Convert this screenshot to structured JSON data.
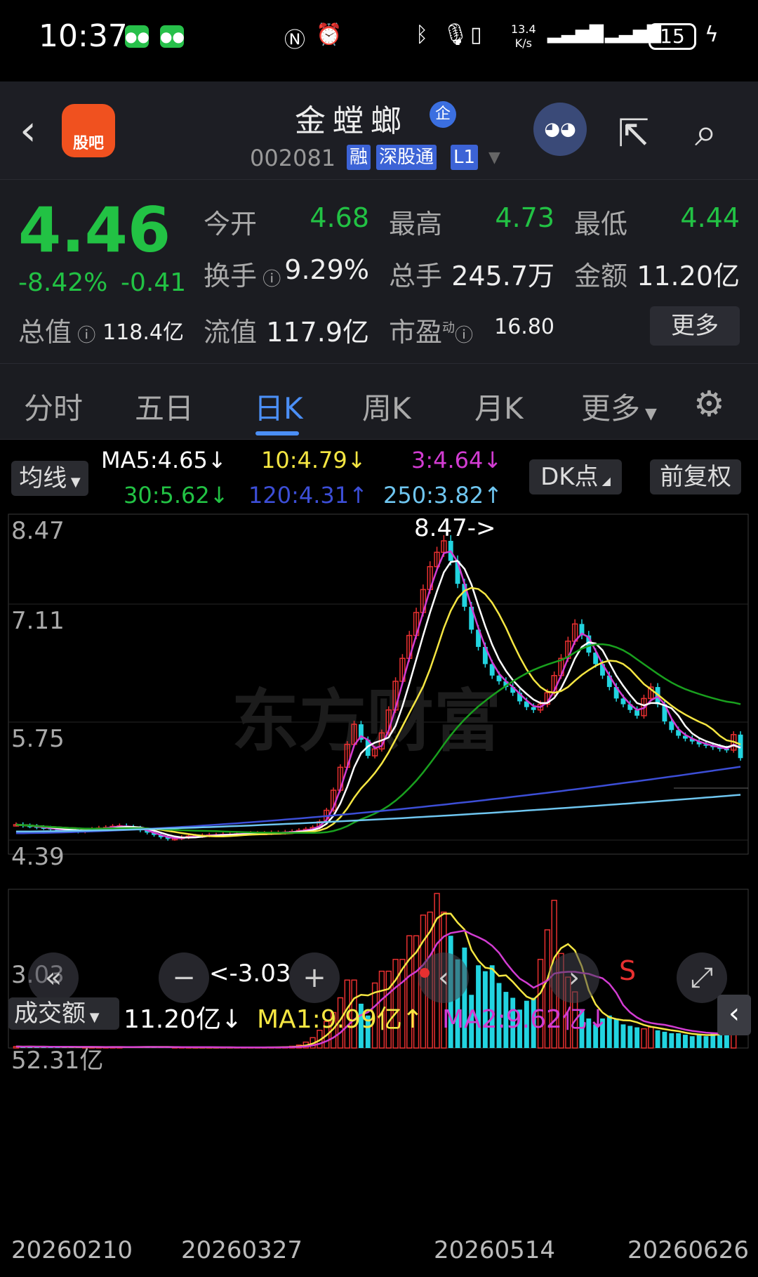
{
  "status_bar": {
    "time": "10:37",
    "net_speed_value": "13.4",
    "net_speed_unit": "K/s",
    "battery": "15"
  },
  "header": {
    "back": "‹",
    "guba_label": "股吧",
    "stock_name": "金螳螂",
    "qi_badge": "企",
    "code": "002081",
    "tags": [
      "融",
      "深股通",
      "L1"
    ]
  },
  "quote": {
    "price": "4.46",
    "change_pct": "-8.42%",
    "change_abs": "-0.41",
    "open_label": "今开",
    "open": "4.68",
    "high_label": "最高",
    "high": "4.73",
    "low_label": "最低",
    "low": "4.44",
    "turnover_label": "换手",
    "turnover": "9.29%",
    "volume_label": "总手",
    "volume": "245.7万",
    "amount_label": "金额",
    "amount": "11.20亿",
    "mktcap_label": "总值",
    "mktcap": "118.4亿",
    "float_label": "流值",
    "float_cap": "117.9亿",
    "pe_label": "市盈",
    "pe_sup": "动",
    "pe": "16.80",
    "more": "更多"
  },
  "tabs": [
    "分时",
    "五日",
    "日K",
    "周K",
    "月K",
    "更多"
  ],
  "active_tab": "日K",
  "indicators": {
    "ma_btn": "均线",
    "ma5": "MA5:4.65↓",
    "ma10": "10:4.79↓",
    "ma3": "3:4.64↓",
    "ma30": "30:5.62↓",
    "ma120": "120:4.31↑",
    "ma250": "250:3.82↑",
    "dk_btn": "DK点",
    "adj_btn": "前复权"
  },
  "colors": {
    "up": "#e83030",
    "down": "#22d4e0",
    "green": "#22c244",
    "ma5": "#ffffff",
    "ma10": "#f5e642",
    "ma3": "#d23cd2",
    "ma30": "#19a01e",
    "ma120": "#3c4ed6",
    "ma250": "#6fc6f0"
  },
  "price_axis": [
    "8.47",
    "7.11",
    "5.75",
    "4.39",
    "3.03"
  ],
  "annotations": {
    "high": "8.47->",
    "low": "<-3.03",
    "sell_marker": "S"
  },
  "volume_panel": {
    "label": "成交额",
    "value": "11.20亿↓",
    "ma1": "MA1:9.99亿↑",
    "ma2": "MA2:9.62亿↓",
    "max_label": "52.31亿"
  },
  "dates": [
    "20260210",
    "20260327",
    "20260514",
    "20260626"
  ],
  "watermark": "东方财富",
  "chart_data": {
    "type": "candlestick",
    "ylim": [
      3.03,
      8.47
    ],
    "closes": [
      3.3,
      3.28,
      3.27,
      3.25,
      3.24,
      3.22,
      3.21,
      3.2,
      3.19,
      3.18,
      3.2,
      3.22,
      3.24,
      3.25,
      3.27,
      3.28,
      3.26,
      3.24,
      3.2,
      3.16,
      3.12,
      3.08,
      3.05,
      3.06,
      3.08,
      3.1,
      3.1,
      3.11,
      3.12,
      3.12,
      3.13,
      3.13,
      3.14,
      3.14,
      3.15,
      3.15,
      3.15,
      3.16,
      3.16,
      3.17,
      3.18,
      3.2,
      3.22,
      3.25,
      3.35,
      3.55,
      3.9,
      4.3,
      4.7,
      5.05,
      4.78,
      4.5,
      4.62,
      4.9,
      5.3,
      5.8,
      6.2,
      6.6,
      7.0,
      7.4,
      7.8,
      8.05,
      8.25,
      7.9,
      7.5,
      7.1,
      6.7,
      6.4,
      6.1,
      5.9,
      5.8,
      5.7,
      5.6,
      5.45,
      5.35,
      5.3,
      5.4,
      5.6,
      5.9,
      6.2,
      6.5,
      6.8,
      6.6,
      6.3,
      6.1,
      5.9,
      5.7,
      5.5,
      5.4,
      5.3,
      5.2,
      5.5,
      5.7,
      5.4,
      5.1,
      4.95,
      4.85,
      4.8,
      4.75,
      4.7,
      4.68,
      4.65,
      4.62,
      4.6,
      4.87,
      4.46
    ],
    "volumes": [
      0.5,
      0.4,
      0.5,
      0.4,
      0.4,
      0.3,
      0.4,
      0.3,
      0.4,
      0.3,
      0.3,
      0.4,
      0.3,
      0.3,
      0.4,
      0.3,
      0.3,
      0.3,
      0.4,
      0.5,
      0.3,
      0.3,
      0.3,
      0.2,
      0.3,
      0.2,
      0.2,
      0.3,
      0.2,
      0.2,
      0.2,
      0.2,
      0.2,
      0.2,
      0.2,
      0.2,
      0.2,
      0.3,
      0.3,
      0.4,
      0.6,
      1.0,
      2.0,
      3.5,
      6.0,
      9.0,
      12.0,
      17.0,
      23.0,
      23.0,
      15.0,
      11.0,
      22.0,
      26.0,
      26.0,
      30.0,
      30.0,
      38.0,
      38.0,
      45.0,
      46.0,
      52.31,
      46.0,
      38.0,
      30.0,
      34.0,
      18.0,
      28.0,
      26.0,
      28.0,
      22.0,
      19.0,
      17.0,
      13.0,
      16.0,
      17.0,
      30.0,
      40.0,
      50.0,
      32.0,
      24.0,
      19.0,
      13.0,
      10.0,
      8.0,
      10.0,
      11.0,
      10.0,
      8.0,
      7.5,
      7.0,
      6.5,
      7.0,
      6.0,
      5.5,
      5.0,
      5.0,
      4.5,
      4.0,
      4.5,
      4.0,
      5.0,
      5.5,
      12.0,
      11.2
    ],
    "ma1_last": 9.99,
    "ma2_last": 9.62
  }
}
